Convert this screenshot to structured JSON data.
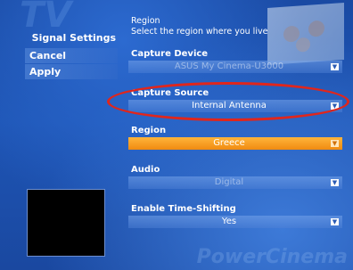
{
  "left": {
    "title": "Signal Settings",
    "cancel_label": "Cancel",
    "apply_label": "Apply"
  },
  "region_header": {
    "title": "Region",
    "description": "Select the region where you live"
  },
  "fields": {
    "capture_device": {
      "label": "Capture Device",
      "value": "ASUS My Cinema-U3000"
    },
    "capture_source": {
      "label": "Capture Source",
      "value": "Internal Antenna"
    },
    "region": {
      "label": "Region",
      "value": "Greece"
    },
    "audio": {
      "label": "Audio",
      "value": "Digital"
    },
    "time_shifting": {
      "label": "Enable Time-Shifting",
      "value": "Yes"
    }
  },
  "colors": {
    "background": "#1c4fa8",
    "active_dropdown": "#f5961c",
    "highlight": "#e0261c"
  },
  "icons": {
    "dropdown_arrow": "chevron-down-icon"
  },
  "branding": {
    "watermark": "PowerCinema"
  }
}
